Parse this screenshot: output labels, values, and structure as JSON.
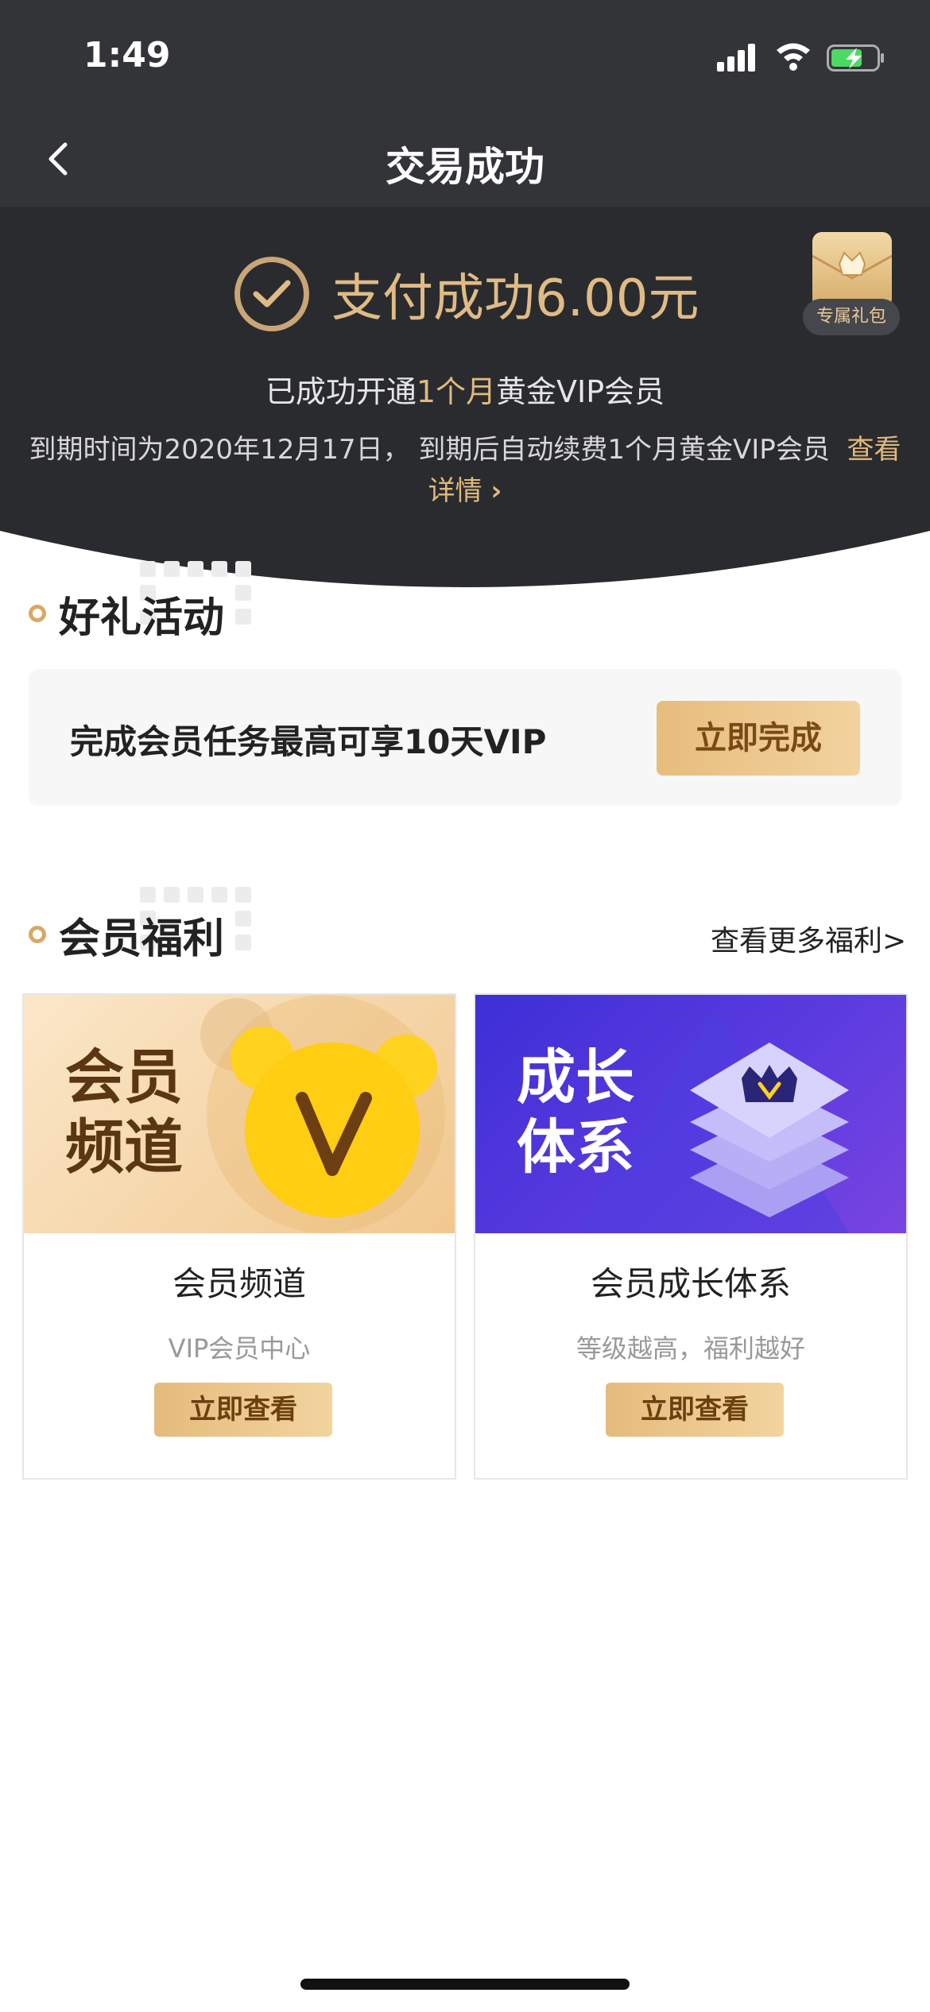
{
  "status_bar": {
    "time": "1:49"
  },
  "nav": {
    "title": "交易成功"
  },
  "success": {
    "headline": "支付成功6.00元",
    "gift_label": "专属礼包",
    "line1_prefix": "已成功开通",
    "line1_highlight": "1个月",
    "line1_suffix": "黄金VIP会员",
    "line2_text": "到期时间为2020年12月17日， 到期后自动续费1个月黄金VIP会员",
    "line2_link": "查看详情",
    "line2_link_arrow": "›"
  },
  "activity": {
    "title": "好礼活动",
    "card_text": "完成会员任务最高可享10天VIP",
    "button_label": "立即完成"
  },
  "benefits": {
    "title": "会员福利",
    "more_link": "查看更多福利>",
    "cards": [
      {
        "image_text_line1": "会员",
        "image_text_line2": "频道",
        "name": "会员频道",
        "sub": "VIP会员中心",
        "button_label": "立即查看"
      },
      {
        "image_text_line1": "成长",
        "image_text_line2": "体系",
        "name": "会员成长体系",
        "sub": "等级越高，福利越好",
        "button_label": "立即查看"
      }
    ]
  },
  "colors": {
    "dark_bg": "#2a2b2f",
    "gold": "#e2b97c",
    "button_gold": "#e7bd7e"
  },
  "icons": [
    "back-chevron-icon",
    "signal-icon",
    "wifi-icon",
    "battery-charging-icon",
    "check-circle-icon",
    "gift-box-icon",
    "crown-v-icon"
  ]
}
